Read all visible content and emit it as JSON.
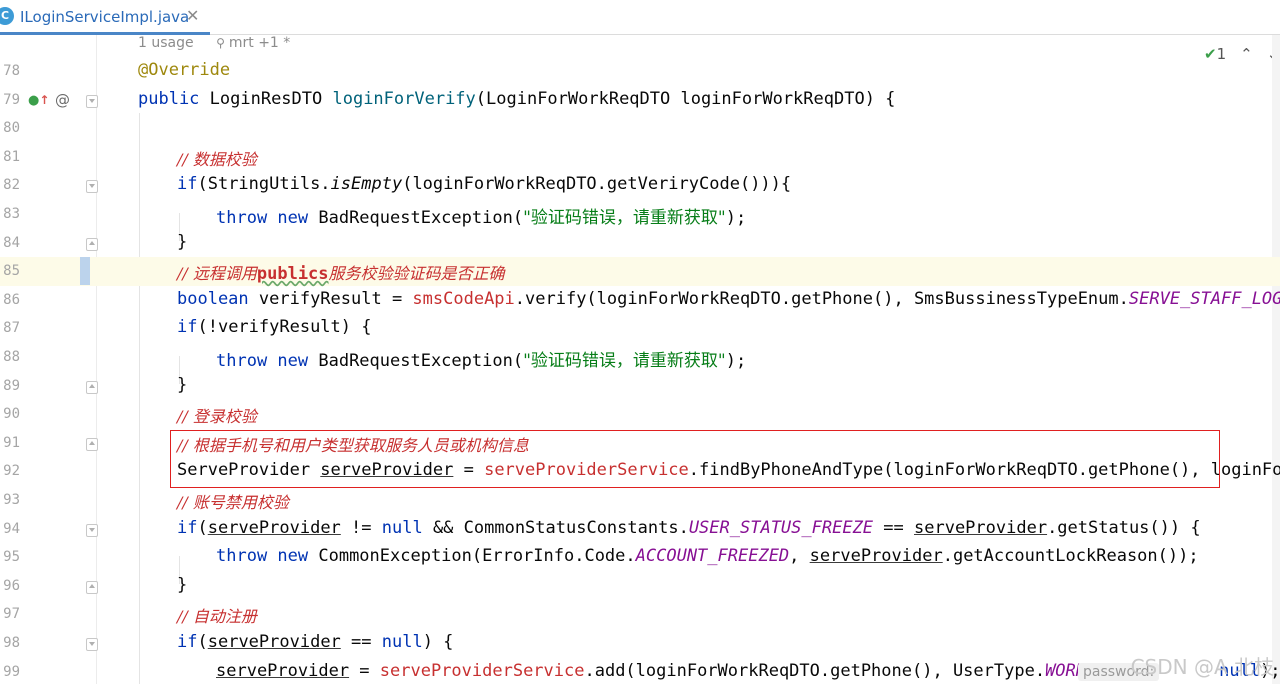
{
  "tab": {
    "icon": "C",
    "title": "ILoginServiceImpl.java",
    "close": "✕"
  },
  "hint": {
    "usage": "1 usage",
    "author": "mrt +1 *"
  },
  "inspection": {
    "count": "1"
  },
  "lines": {
    "l78": {
      "n": "78"
    },
    "l79": {
      "n": "79"
    },
    "l80": {
      "n": "80"
    },
    "l81": {
      "n": "81",
      "comment": "// 数据校验"
    },
    "l82": {
      "n": "82"
    },
    "l83": {
      "n": "83",
      "msg": "\"验证码错误，请重新获取\""
    },
    "l84": {
      "n": "84"
    },
    "l85": {
      "n": "85",
      "c1": "// 远程调用",
      "c2": "publics",
      "c3": "服务校验验证码是否正确"
    },
    "l86": {
      "n": "86"
    },
    "l87": {
      "n": "87"
    },
    "l88": {
      "n": "88",
      "msg": "\"验证码错误，请重新获取\""
    },
    "l89": {
      "n": "89"
    },
    "l90": {
      "n": "90",
      "comment": "// 登录校验"
    },
    "l91": {
      "n": "91",
      "comment": "// 根据手机号和用户类型获取服务人员或机构信息"
    },
    "l92": {
      "n": "92"
    },
    "l93": {
      "n": "93",
      "comment": "// 账号禁用校验"
    },
    "l94": {
      "n": "94"
    },
    "l95": {
      "n": "95"
    },
    "l96": {
      "n": "96"
    },
    "l97": {
      "n": "97",
      "comment": "// 自动注册"
    },
    "l98": {
      "n": "98"
    },
    "l99": {
      "n": "99",
      "param_hint": "password:"
    }
  },
  "watermark": "CSDN @A 北枝",
  "colors": {
    "keyword": "#0033b3",
    "comment": "#c73030",
    "string": "#067d17",
    "annotation": "#9e880d",
    "field": "#871094",
    "highlight_box": "#e02020"
  }
}
